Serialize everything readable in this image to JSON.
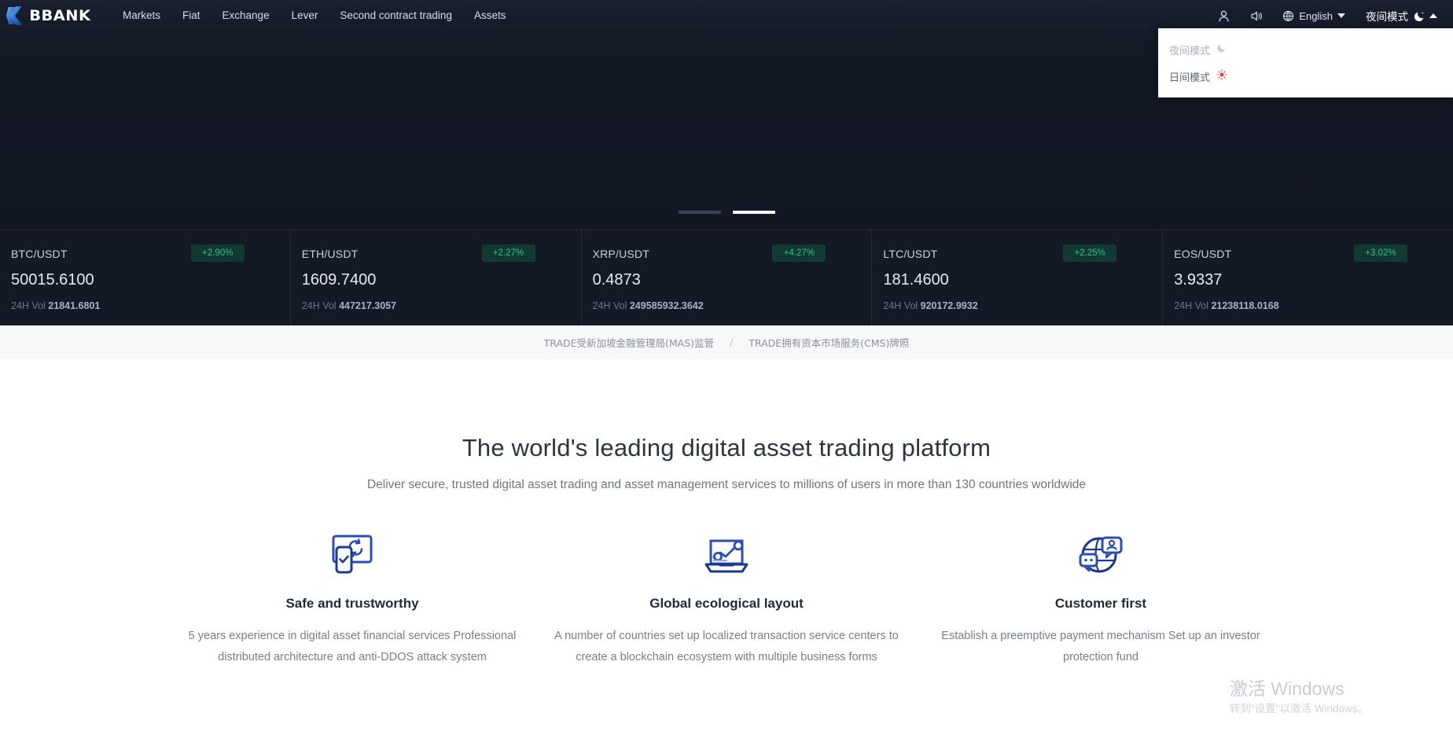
{
  "header": {
    "logo_text": "BBANK",
    "logo_icon": "k-logo-icon",
    "nav": [
      {
        "label": "Markets"
      },
      {
        "label": "Fiat"
      },
      {
        "label": "Exchange"
      },
      {
        "label": "Lever"
      },
      {
        "label": "Second contract trading"
      },
      {
        "label": "Assets"
      }
    ],
    "account_icon": "user-account-icon",
    "sound_icon": "speaker-volume-icon",
    "globe_icon": "globe-icon",
    "language": "English",
    "language_caret": "chevron-down-icon",
    "mode_label": "夜间模式",
    "mode_icon": "moon-icon",
    "mode_caret": "chevron-up-icon"
  },
  "mode_dropdown": {
    "options": [
      {
        "label": "夜间模式",
        "icon": "moon-icon",
        "glyph": "☾",
        "active": true
      },
      {
        "label": "日间模式",
        "icon": "sun-icon",
        "glyph": "☀",
        "active": false
      }
    ]
  },
  "carousel": {
    "slides": 2,
    "active_index": 1
  },
  "tickers": [
    {
      "pair": "BTC/USDT",
      "change": "+2.90%",
      "price": "50015.6100",
      "vol_label": "24H Vol",
      "volume": "21841.6801"
    },
    {
      "pair": "ETH/USDT",
      "change": "+2.27%",
      "price": "1609.7400",
      "vol_label": "24H Vol",
      "volume": "447217.3057"
    },
    {
      "pair": "XRP/USDT",
      "change": "+4.27%",
      "price": "0.4873",
      "vol_label": "24H Vol",
      "volume": "249585932.3642"
    },
    {
      "pair": "LTC/USDT",
      "change": "+2.25%",
      "price": "181.4600",
      "vol_label": "24H Vol",
      "volume": "920172.9932"
    },
    {
      "pair": "EOS/USDT",
      "change": "+3.02%",
      "price": "3.9337",
      "vol_label": "24H Vol",
      "volume": "21238118.0168"
    }
  ],
  "license_bar": {
    "left": "TRADE受新加坡金融管理局(MAS)监管",
    "separator": "/",
    "right": "TRADE拥有资本市场服务(CMS)牌照"
  },
  "main": {
    "title": "The world's leading digital asset trading platform",
    "subtitle": "Deliver secure, trusted digital asset trading and asset management services to millions of users in more than 130 countries worldwide",
    "features": [
      {
        "icon": "monitor-sync-phone-check-icon",
        "title": "Safe and trustworthy",
        "desc": "5 years experience in digital asset financial services Professional distributed architecture and anti-DDOS attack system"
      },
      {
        "icon": "laptop-chart-icon",
        "title": "Global ecological layout",
        "desc": "A number of countries set up localized transaction service centers to create a blockchain ecosystem with multiple business forms"
      },
      {
        "icon": "globe-chat-people-icon",
        "title": "Customer first",
        "desc": "Establish a preemptive payment mechanism Set up an investor protection fund"
      }
    ]
  },
  "watermark": {
    "line1": "激活 Windows",
    "line2": "转到\"设置\"以激活 Windows。"
  },
  "colors": {
    "dark_bg": "#141925",
    "header_bg": "#181e2c",
    "accent_green": "#2fbf8f",
    "badge_bg": "#123a33",
    "icon_blue": "#2b4fb0",
    "text_light": "#e6ebf3"
  }
}
